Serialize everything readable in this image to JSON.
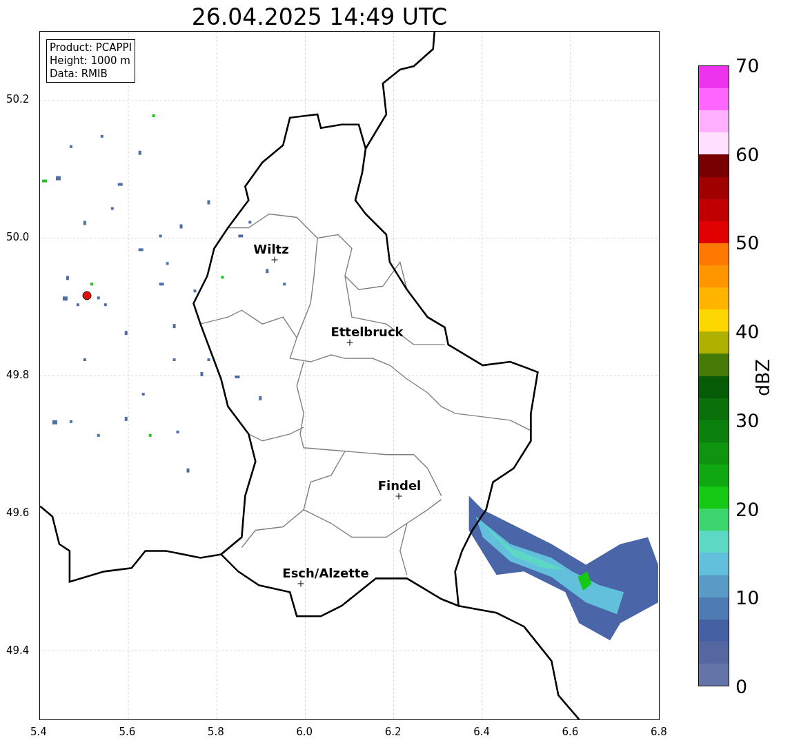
{
  "title": "26.04.2025 14:49 UTC",
  "info_box": [
    "Product: PCAPPI",
    "Height: 1000 m",
    "Data: RMIB"
  ],
  "cities": [
    {
      "name": "Wiltz"
    },
    {
      "name": "Ettelbruck"
    },
    {
      "name": "Findel"
    },
    {
      "name": "Esch/Alzette"
    }
  ],
  "y_ticks": [
    "50.2",
    "50.0",
    "49.8",
    "49.6",
    "49.4"
  ],
  "x_ticks": [
    "5.4",
    "5.6",
    "5.8",
    "6.0",
    "6.2",
    "6.4",
    "6.6",
    "6.8"
  ],
  "colorbar": {
    "label": "dBZ",
    "ticks": [
      "70",
      "60",
      "50",
      "40",
      "30",
      "20",
      "10",
      "0"
    ],
    "bins": [
      {
        "color": "#ee33ee"
      },
      {
        "color": "#ff66ff"
      },
      {
        "color": "#ffb0ff"
      },
      {
        "color": "#ffe0ff"
      },
      {
        "color": "#780000"
      },
      {
        "color": "#a00000"
      },
      {
        "color": "#c00000"
      },
      {
        "color": "#e00000"
      },
      {
        "color": "#ff7800"
      },
      {
        "color": "#ff9600"
      },
      {
        "color": "#ffb400"
      },
      {
        "color": "#ffd700"
      },
      {
        "color": "#b0b000"
      },
      {
        "color": "#467a06"
      },
      {
        "color": "#065c06"
      },
      {
        "color": "#0a700a"
      },
      {
        "color": "#0c800c"
      },
      {
        "color": "#0e940e"
      },
      {
        "color": "#10a810"
      },
      {
        "color": "#14c814"
      },
      {
        "color": "#3cd46c"
      },
      {
        "color": "#5dd8c4"
      },
      {
        "color": "#62c0dc"
      },
      {
        "color": "#5a9ac6"
      },
      {
        "color": "#4e7bb4"
      },
      {
        "color": "#4660a4"
      },
      {
        "color": "#5467a0"
      },
      {
        "color": "#6473a8"
      }
    ]
  }
}
